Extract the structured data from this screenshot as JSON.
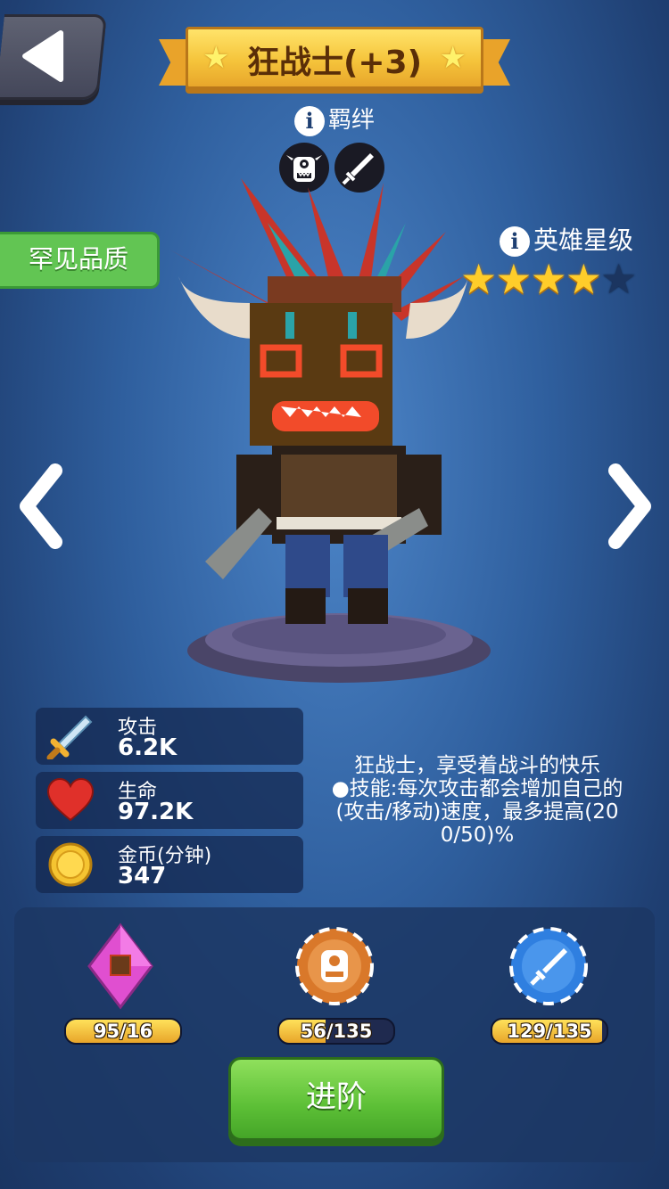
{
  "header": {
    "title": "狂战士(+3)"
  },
  "bond": {
    "label": "羁绊",
    "icons": [
      "ogre-face-icon",
      "sword-icon"
    ]
  },
  "rarity_label": "罕见品质",
  "hero_star": {
    "label": "英雄星级",
    "stars_filled": 4,
    "stars_total": 5
  },
  "stats": [
    {
      "icon": "sword-icon",
      "label": "攻击",
      "value": "6.2K"
    },
    {
      "icon": "heart-icon",
      "label": "生命",
      "value": "97.2K"
    },
    {
      "icon": "gold-coin-icon",
      "label": "金币(分钟)",
      "value": "347"
    }
  ],
  "description": {
    "line1": "狂战士，享受着战斗的快乐",
    "line2": "●技能:每次攻击都会增加自己的",
    "line3": "(攻击/移动)速度，最多提高(20",
    "line4": "0/50)%"
  },
  "upgrade_items": [
    {
      "icon": "hero-card-gem-icon",
      "progress_text": "95/16",
      "progress_fraction": 1.0
    },
    {
      "icon": "ogre-token-icon",
      "progress_text": "56/135",
      "progress_fraction": 0.41
    },
    {
      "icon": "sword-token-icon",
      "progress_text": "129/135",
      "progress_fraction": 0.96
    }
  ],
  "advance_button": "进阶",
  "colors": {
    "ribbon": "#f5c43b",
    "rarity_green": "#62c553",
    "advance_green": "#5cbf36",
    "star_gold": "#ffcd2a"
  }
}
